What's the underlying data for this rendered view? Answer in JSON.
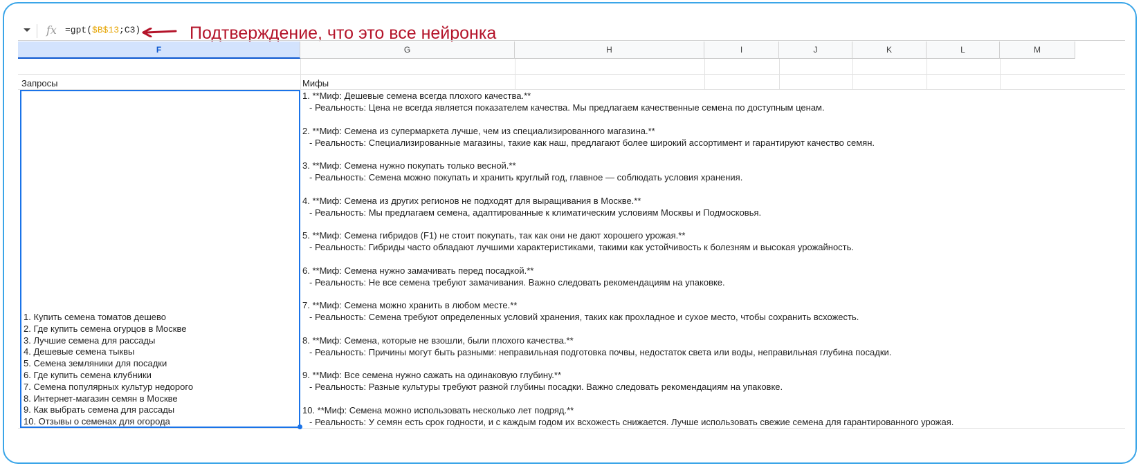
{
  "formula_bar": {
    "dropdown_icon": "caret-down-icon",
    "fx_label": "fx",
    "formula_prefix": "=gpt(",
    "formula_ref": "$B$13",
    "formula_suffix": ";C3)"
  },
  "annotation": {
    "text": "Подтверждение, что это все нейронка",
    "color": "#b4142a"
  },
  "columns": [
    "F",
    "G",
    "H",
    "I",
    "J",
    "K",
    "L",
    "M"
  ],
  "selected_column": "F",
  "cells": {
    "f_header": "Запросы",
    "g_header": "Мифы"
  },
  "queries": [
    "1. Купить семена томатов дешево",
    "2. Где купить семена огурцов в Москве",
    "3. Лучшие семена для рассады",
    "4. Дешевые семена тыквы",
    "5. Семена земляники для посадки",
    "6. Где купить семена клубники",
    "7. Семена популярных культур недорого",
    "8. Интернет-магазин семян в Москве",
    "9. Как выбрать семена для рассады",
    "10. Отзывы о семенах для огорода"
  ],
  "myths": [
    {
      "title": "1. **Миф: Дешевые семена всегда плохого качества.**",
      "reality": "- Реальность: Цена не всегда является показателем качества. Мы предлагаем качественные семена по доступным ценам."
    },
    {
      "title": "2. **Миф: Семена из супермаркета лучше, чем из специализированного магазина.**",
      "reality": "- Реальность: Специализированные магазины, такие как наш, предлагают более широкий ассортимент и гарантируют качество семян."
    },
    {
      "title": "3. **Миф: Семена нужно покупать только весной.**",
      "reality": "- Реальность: Семена можно покупать и хранить круглый год, главное — соблюдать условия хранения."
    },
    {
      "title": "4. **Миф: Семена из других регионов не подходят для выращивания в Москве.**",
      "reality": "- Реальность: Мы предлагаем семена, адаптированные к климатическим условиям Москвы и Подмосковья."
    },
    {
      "title": "5. **Миф: Семена гибридов (F1) не стоит покупать, так как они не дают хорошего урожая.**",
      "reality": "- Реальность: Гибриды часто обладают лучшими характеристиками, такими как устойчивость к болезням и высокая урожайность."
    },
    {
      "title": "6. **Миф: Семена нужно замачивать перед посадкой.**",
      "reality": "- Реальность: Не все семена требуют замачивания. Важно следовать рекомендациям на упаковке."
    },
    {
      "title": "7. **Миф: Семена можно хранить в любом месте.**",
      "reality": "- Реальность: Семена требуют определенных условий хранения, таких как прохладное и сухое место, чтобы сохранить всхожесть."
    },
    {
      "title": "8. **Миф: Семена, которые не взошли, были плохого качества.**",
      "reality": "- Реальность: Причины могут быть разными: неправильная подготовка почвы, недостаток света или воды, неправильная глубина посадки."
    },
    {
      "title": "9. **Миф: Все семена нужно сажать на одинаковую глубину.**",
      "reality": "- Реальность: Разные культуры требуют разной глубины посадки. Важно следовать рекомендациям на упаковке."
    },
    {
      "title": "10. **Миф: Семена можно использовать несколько лет подряд.**",
      "reality": "- Реальность: У семян есть срок годности, и с каждым годом их всхожесть снижается. Лучше использовать свежие семена для гарантированного урожая."
    }
  ]
}
